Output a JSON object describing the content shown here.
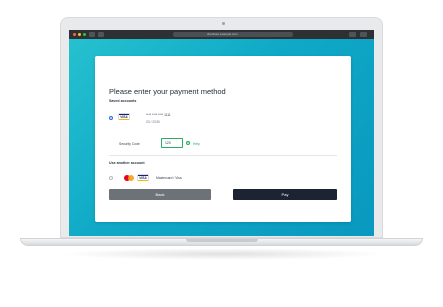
{
  "browser": {
    "address": "checkout.example.com"
  },
  "payment": {
    "title": "Please enter your payment method",
    "saved_section_label": "Saved accounts",
    "saved_card": {
      "brand": "VISA",
      "masked_number": "**** **** **** 1111",
      "expiry": "03 / 2030"
    },
    "security_code_label": "Security Code",
    "security_code_value": "123",
    "help_label": "Help",
    "other_section_label": "Use another account",
    "other_brands_label": "Mastercard / Visa",
    "other_visa_label": "VISA",
    "back_label": "Back",
    "pay_label": "Pay"
  },
  "colors": {
    "screen_gradient": [
      "#26c2cf",
      "#0a98bf"
    ],
    "pay_button": "#1c2433",
    "back_button": "#6d7278",
    "valid_green": "#27ae60"
  }
}
